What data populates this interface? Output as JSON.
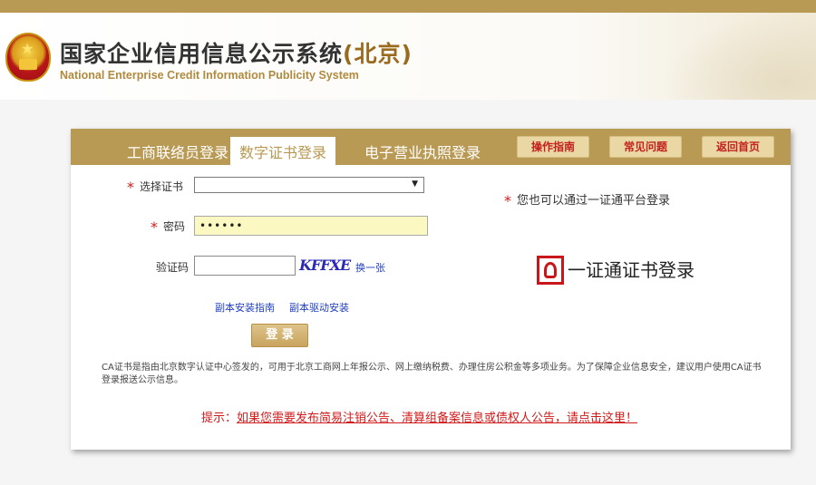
{
  "header": {
    "title_main": "国家企业信用信息公示系统",
    "title_region": "(北京)",
    "title_en": "National Enterprise Credit Information Publicity System"
  },
  "tabs": [
    {
      "label": "工商联络员登录",
      "active": false
    },
    {
      "label": "数字证书登录",
      "active": true
    },
    {
      "label": "电子营业执照登录",
      "active": false
    }
  ],
  "top_buttons": {
    "guide": "操作指南",
    "faq": "常见问题",
    "home": "返回首页"
  },
  "form": {
    "cert_label": "选择证书",
    "cert_value": "",
    "password_label": "密码",
    "password_value": "••••••",
    "captcha_label": "验证码",
    "captcha_value": "",
    "captcha_text": "KFFXE",
    "captcha_refresh": "换一张",
    "install_guide": "副本安装指南",
    "driver_install": "副本驱动安装",
    "submit": "登 录"
  },
  "alt_login": {
    "note": "您也可以通过一证通平台登录",
    "label": "一证通证书登录"
  },
  "description": "CA证书是指由北京数字认证中心签发的，可用于北京工商网上年报公示、网上缴纳税费、办理住房公积金等多项业务。为了保障企业信息安全，建议用户使用CA证书登录报送公示信息。",
  "notice": {
    "prefix": "提示：",
    "link": "如果您需要发布简易注销公告、清算组备案信息或债权人公告，请点击这里！"
  },
  "colors": {
    "brand_gold": "#b99a54",
    "accent_red": "#d11a1a",
    "link_blue": "#1f3fbf"
  }
}
